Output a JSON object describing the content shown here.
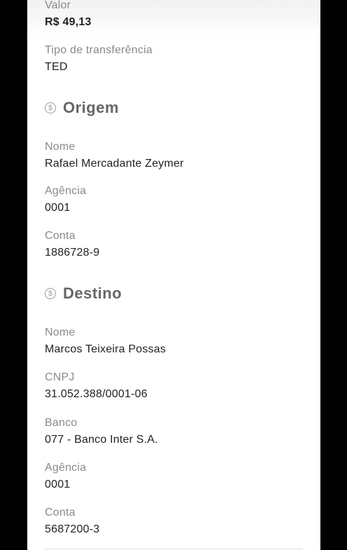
{
  "valor": {
    "label": "Valor",
    "value": "R$ 49,13"
  },
  "tipo": {
    "label": "Tipo de transferência",
    "value": "TED"
  },
  "origem": {
    "title": "Origem",
    "icon": "dollar-coin-icon",
    "nome": {
      "label": "Nome",
      "value": "Rafael Mercadante Zeymer"
    },
    "agencia": {
      "label": "Agência",
      "value": "0001"
    },
    "conta": {
      "label": "Conta",
      "value": "1886728-9"
    }
  },
  "destino": {
    "title": "Destino",
    "icon": "dollar-coin-icon",
    "nome": {
      "label": "Nome",
      "value": "Marcos Teixeira Possas"
    },
    "cnpj": {
      "label": "CNPJ",
      "value": "31.052.388/0001-06"
    },
    "banco": {
      "label": "Banco",
      "value": "077 - Banco Inter S.A."
    },
    "agencia": {
      "label": "Agência",
      "value": "0001"
    },
    "conta": {
      "label": "Conta",
      "value": "5687200-3"
    }
  }
}
